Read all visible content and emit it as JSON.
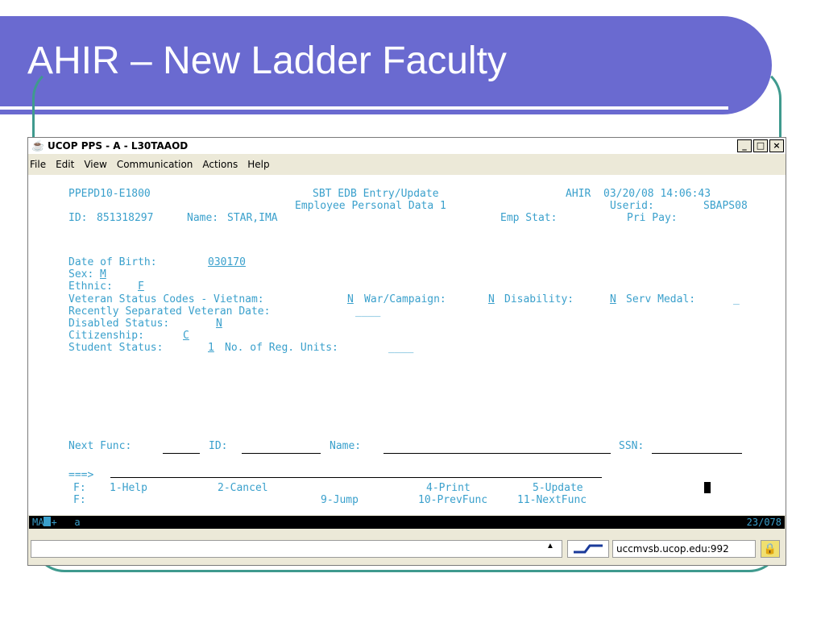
{
  "slide": {
    "title": "AHIR – New Ladder Faculty",
    "colors": {
      "title_bar": "#6a6ad0",
      "accent_line": "#3f9a8e"
    }
  },
  "window": {
    "title": "UCOP PPS - A - L30TAAOD",
    "app_icon": "java-cup-icon",
    "controls": {
      "minimize": "_",
      "maximize": "□",
      "close": "×"
    },
    "menu": [
      "File",
      "Edit",
      "View",
      "Communication",
      "Actions",
      "Help"
    ]
  },
  "terminal": {
    "text_color": "#3aa0cc",
    "header": {
      "screen_id": "PPEPD10-E1800",
      "system": "SBT EDB Entry/Update",
      "func": "AHIR",
      "date_time": "03/20/08 14:06:43",
      "subtitle": "Employee Personal Data 1",
      "userid_label": "Userid:",
      "userid": "SBAPS08",
      "id_label": "ID:",
      "id": "851318297",
      "name_label": "Name:",
      "name": "STAR,IMA",
      "emp_stat_label": "Emp Stat:",
      "pri_pay_label": "Pri Pay:"
    },
    "fields": {
      "dob_label": "Date of Birth:",
      "dob": "030170",
      "sex_label": "Sex:",
      "sex": "M",
      "ethnic_label": "Ethnic:",
      "ethnic": "F",
      "vet_label": "Veteran Status Codes - Vietnam:",
      "vietnam": "N",
      "war_label": "War/Campaign:",
      "war": "N",
      "disability_label": "Disability:",
      "disability": "N",
      "serv_medal_label": "Serv Medal:",
      "serv_medal": "_",
      "recent_vet_label": "Recently Separated Veteran Date:",
      "recent_vet": "____",
      "disabled_label": "Disabled Status:",
      "disabled": "N",
      "citizenship_label": "Citizenship:",
      "citizenship": "C",
      "student_label": "Student Status:",
      "student": "1",
      "reg_units_label": "No. of Reg. Units:",
      "reg_units": "____"
    },
    "nav": {
      "next_func_label": "Next Func:",
      "id_label": "ID:",
      "name_label": "Name:",
      "ssn_label": "SSN:",
      "command_prompt": "===>"
    },
    "pf_keys": {
      "row1_prefix": "F:",
      "row1": [
        "1-Help",
        "2-Cancel",
        "4-Print",
        "5-Update"
      ],
      "row2_prefix": "F:",
      "row2": [
        "9-Jump",
        "10-PrevFunc",
        "11-NextFunc"
      ]
    }
  },
  "oia": {
    "left_ma": "MA",
    "left_rest": "+   a",
    "cursor_pos": "23/078"
  },
  "statusbar": {
    "host": "uccmvsb.ucop.edu:992",
    "connection_icon": "connection-icon",
    "lock_icon": "lock-icon"
  }
}
